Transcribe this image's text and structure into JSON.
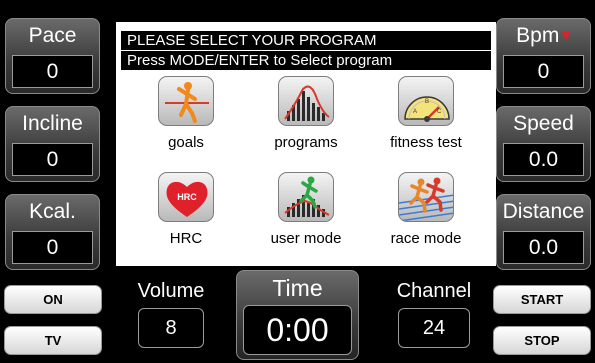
{
  "left_stats": [
    {
      "label": "Pace",
      "value": "0"
    },
    {
      "label": "Incline",
      "value": "0"
    },
    {
      "label": "Kcal.",
      "value": "0"
    }
  ],
  "right_stats": [
    {
      "label": "Bpm",
      "value": "0"
    },
    {
      "label": "Speed",
      "value": "0.0"
    },
    {
      "label": "Distance",
      "value": "0.0"
    }
  ],
  "screen": {
    "title": "PLEASE SELECT YOUR PROGRAM",
    "subtitle": "Press MODE/ENTER to Select program",
    "programs": [
      {
        "label": "goals",
        "icon": "runner-goal-icon"
      },
      {
        "label": "programs",
        "icon": "bar-chart-icon"
      },
      {
        "label": "fitness test",
        "icon": "gauge-icon"
      },
      {
        "label": "HRC",
        "icon": "hrc-heart-icon",
        "badge": "HRC"
      },
      {
        "label": "user mode",
        "icon": "user-runner-chart-icon"
      },
      {
        "label": "race mode",
        "icon": "race-runners-icon"
      }
    ]
  },
  "buttons": {
    "on": "ON",
    "tv": "TV",
    "start": "START",
    "stop": "STOP"
  },
  "bottom": {
    "volume_label": "Volume",
    "volume_value": "8",
    "time_label": "Time",
    "time_value": "0:00",
    "channel_label": "Channel",
    "channel_value": "24"
  },
  "colors": {
    "heart": "#e0202a",
    "panel_dark": "#3a3a3a",
    "screen_bg": "#ffffff"
  }
}
